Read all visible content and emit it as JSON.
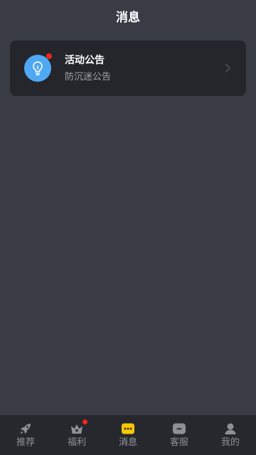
{
  "header": {
    "title": "消息"
  },
  "notice_card": {
    "title": "活动公告",
    "subtitle": "防沉迷公告",
    "icon": "lightbulb-icon",
    "has_unread": true
  },
  "tabbar": {
    "items": [
      {
        "label": "推荐",
        "icon": "rocket-icon",
        "badge": false,
        "active": false
      },
      {
        "label": "福利",
        "icon": "crown-icon",
        "badge": true,
        "active": false
      },
      {
        "label": "消息",
        "icon": "message-icon",
        "badge": false,
        "active": true
      },
      {
        "label": "客服",
        "icon": "service-icon",
        "badge": false,
        "active": false
      },
      {
        "label": "我的",
        "icon": "user-icon",
        "badge": false,
        "active": false
      }
    ]
  },
  "colors": {
    "background": "#393b45",
    "card": "#24262c",
    "tabbar": "#26282e",
    "accent": "#f7c600",
    "badge": "#f0261c",
    "icon_blue": "#4fa8f2"
  }
}
